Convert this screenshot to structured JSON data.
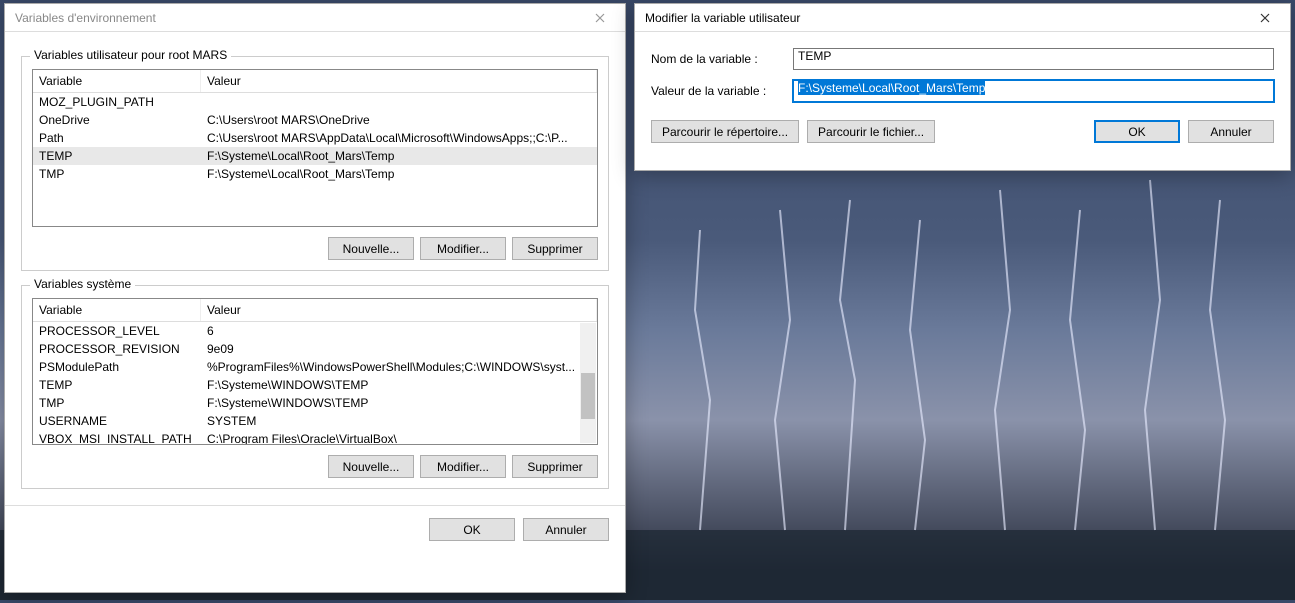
{
  "env_window": {
    "title": "Variables d'environnement",
    "user_group_title": "Variables utilisateur pour root MARS",
    "system_group_title": "Variables système",
    "col_variable": "Variable",
    "col_value": "Valeur",
    "user_vars": [
      {
        "name": "MOZ_PLUGIN_PATH",
        "value": ""
      },
      {
        "name": "OneDrive",
        "value": "C:\\Users\\root MARS\\OneDrive"
      },
      {
        "name": "Path",
        "value": "C:\\Users\\root MARS\\AppData\\Local\\Microsoft\\WindowsApps;;C:\\P..."
      },
      {
        "name": "TEMP",
        "value": "F:\\Systeme\\Local\\Root_Mars\\Temp"
      },
      {
        "name": "TMP",
        "value": "F:\\Systeme\\Local\\Root_Mars\\Temp"
      }
    ],
    "system_vars": [
      {
        "name": "PROCESSOR_LEVEL",
        "value": "6"
      },
      {
        "name": "PROCESSOR_REVISION",
        "value": "9e09"
      },
      {
        "name": "PSModulePath",
        "value": "%ProgramFiles%\\WindowsPowerShell\\Modules;C:\\WINDOWS\\syst..."
      },
      {
        "name": "TEMP",
        "value": "F:\\Systeme\\WINDOWS\\TEMP"
      },
      {
        "name": "TMP",
        "value": "F:\\Systeme\\WINDOWS\\TEMP"
      },
      {
        "name": "USERNAME",
        "value": "SYSTEM"
      },
      {
        "name": "VBOX_MSI_INSTALL_PATH",
        "value": "C:\\Program Files\\Oracle\\VirtualBox\\"
      }
    ],
    "btn_new": "Nouvelle...",
    "btn_edit": "Modifier...",
    "btn_delete": "Supprimer",
    "btn_ok": "OK",
    "btn_cancel": "Annuler"
  },
  "edit_window": {
    "title": "Modifier la variable utilisateur",
    "label_name": "Nom de la variable :",
    "label_value": "Valeur de la variable :",
    "value_name": "TEMP",
    "value_value": "F:\\Systeme\\Local\\Root_Mars\\Temp",
    "btn_browse_dir": "Parcourir le répertoire...",
    "btn_browse_file": "Parcourir le fichier...",
    "btn_ok": "OK",
    "btn_cancel": "Annuler"
  }
}
